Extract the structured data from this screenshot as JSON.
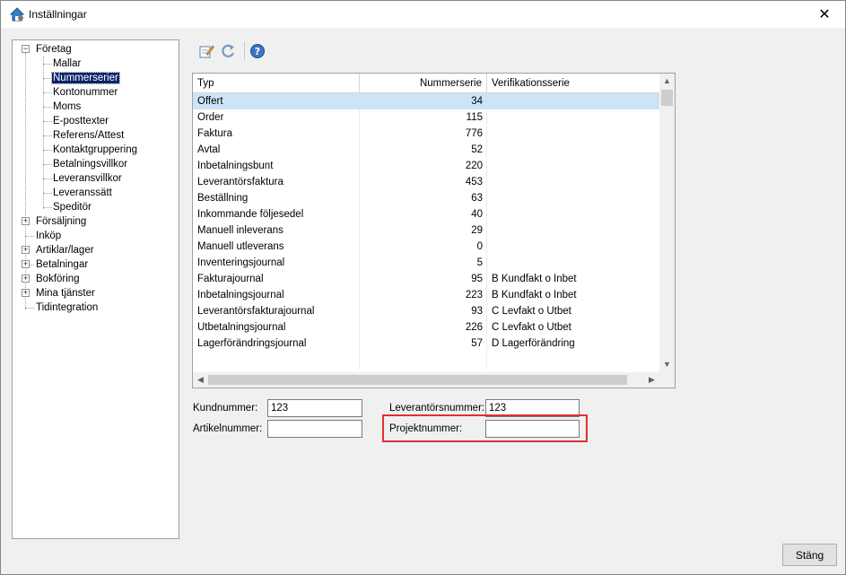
{
  "window": {
    "title": "Inställningar",
    "close_glyph": "✕"
  },
  "colors": {
    "selection": "#0a246a",
    "row_highlight": "#cce4f7",
    "callout": "#e03030"
  },
  "tree": {
    "expand_glyph": "+",
    "collapse_glyph": "−",
    "items": [
      {
        "label": "Företag"
      },
      {
        "label": "Mallar"
      },
      {
        "label": "Nummerserier"
      },
      {
        "label": "Kontonummer"
      },
      {
        "label": "Moms"
      },
      {
        "label": "E-posttexter"
      },
      {
        "label": "Referens/Attest"
      },
      {
        "label": "Kontaktgruppering"
      },
      {
        "label": "Betalningsvillkor"
      },
      {
        "label": "Leveransvillkor"
      },
      {
        "label": "Leveranssätt"
      },
      {
        "label": "Speditör"
      },
      {
        "label": "Försäljning"
      },
      {
        "label": "Inköp"
      },
      {
        "label": "Artiklar/lager"
      },
      {
        "label": "Betalningar"
      },
      {
        "label": "Bokföring"
      },
      {
        "label": "Mina tjänster"
      },
      {
        "label": "Tidintegration"
      }
    ]
  },
  "toolbar": {
    "icons": [
      "edit-icon",
      "refresh-icon",
      "help-icon"
    ]
  },
  "grid": {
    "headers": {
      "typ": "Typ",
      "nummerserie": "Nummerserie",
      "verifikation": "Verifikationsserie"
    },
    "rows": [
      {
        "typ": "Offert",
        "num": "34",
        "ver": ""
      },
      {
        "typ": "Order",
        "num": "115",
        "ver": ""
      },
      {
        "typ": "Faktura",
        "num": "776",
        "ver": ""
      },
      {
        "typ": "Avtal",
        "num": "52",
        "ver": ""
      },
      {
        "typ": "Inbetalningsbunt",
        "num": "220",
        "ver": ""
      },
      {
        "typ": "Leverantörsfaktura",
        "num": "453",
        "ver": ""
      },
      {
        "typ": "Beställning",
        "num": "63",
        "ver": ""
      },
      {
        "typ": "Inkommande följesedel",
        "num": "40",
        "ver": ""
      },
      {
        "typ": "Manuell inleverans",
        "num": "29",
        "ver": ""
      },
      {
        "typ": "Manuell utleverans",
        "num": "0",
        "ver": ""
      },
      {
        "typ": "Inventeringsjournal",
        "num": "5",
        "ver": ""
      },
      {
        "typ": "Fakturajournal",
        "num": "95",
        "ver": "B  Kundfakt o Inbet"
      },
      {
        "typ": "Inbetalningsjournal",
        "num": "223",
        "ver": "B  Kundfakt o Inbet"
      },
      {
        "typ": "Leverantörsfakturajournal",
        "num": "93",
        "ver": "C  Levfakt o Utbet"
      },
      {
        "typ": "Utbetalningsjournal",
        "num": "226",
        "ver": "C  Levfakt o Utbet"
      },
      {
        "typ": "Lagerförändringsjournal",
        "num": "57",
        "ver": "D  Lagerförändring"
      }
    ],
    "scroll": {
      "up": "▲",
      "down": "▼",
      "left": "◀",
      "right": "▶"
    }
  },
  "fields": {
    "kundnummer": {
      "label": "Kundnummer:",
      "value": "123"
    },
    "artikelnummer": {
      "label": "Artikelnummer:",
      "value": ""
    },
    "leverantorsnummer": {
      "label": "Leverantörsnummer:",
      "value": "123"
    },
    "projektnummer": {
      "label": "Projektnummer:",
      "value": ""
    }
  },
  "buttons": {
    "stang": "Stäng"
  }
}
